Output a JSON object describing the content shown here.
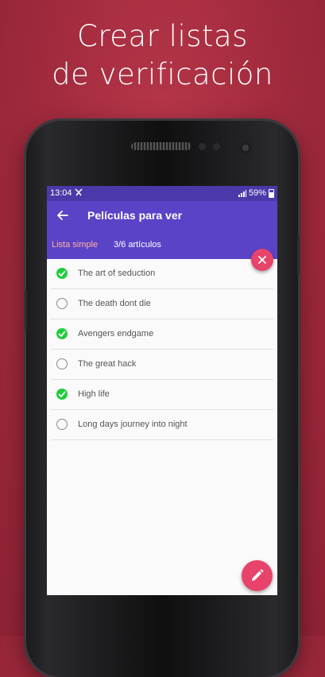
{
  "headline": {
    "line1": "Crear listas",
    "line2": "de verificación"
  },
  "status_bar": {
    "time": "13:04",
    "battery": "59%"
  },
  "app_bar": {
    "title": "Películas para ver"
  },
  "sub_bar": {
    "list_type": "Lista simple",
    "count": "3/6 artículos"
  },
  "items": [
    {
      "label": "The art of seduction",
      "checked": true
    },
    {
      "label": "The death dont die",
      "checked": false
    },
    {
      "label": "Avengers endgame",
      "checked": true
    },
    {
      "label": "The great hack",
      "checked": false
    },
    {
      "label": "High life",
      "checked": true
    },
    {
      "label": "Long days journey into night",
      "checked": false
    }
  ],
  "icons": {
    "back": "arrow-left-icon",
    "close": "close-icon",
    "edit": "pencil-icon",
    "checked": "check-circle-icon",
    "unchecked": "empty-circle-icon"
  },
  "colors": {
    "background": "#a52c3f",
    "primary": "#5a43c6",
    "status_bar": "#4b39a9",
    "accent": "#e8436a",
    "check": "#1fcf3a",
    "list_type_text": "#ffb3a1"
  }
}
